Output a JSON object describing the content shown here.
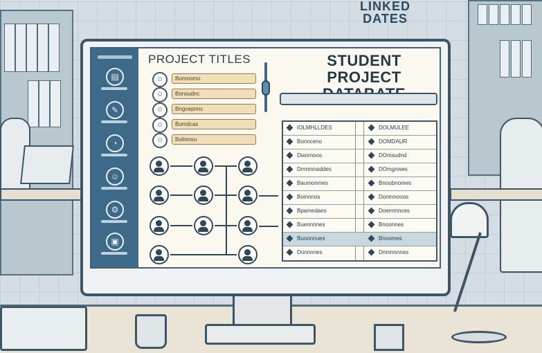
{
  "wall_sign": {
    "line1": "LINKED",
    "line2": "DATES"
  },
  "colors": {
    "sidebar": "#3d6a88",
    "accent_bar": "#f0dfb8",
    "ink": "#243f50"
  },
  "sidebar": {
    "items": [
      {
        "icon": "document-icon"
      },
      {
        "icon": "edit-icon"
      },
      {
        "icon": "chart-icon"
      },
      {
        "icon": "user-icon"
      },
      {
        "icon": "settings-icon"
      },
      {
        "icon": "archive-icon"
      }
    ]
  },
  "projects": {
    "title": "PROJECT TITLES",
    "rows": [
      {
        "label": "Bomnomo"
      },
      {
        "label": "Bonsudnc"
      },
      {
        "label": "Bngoepnnc"
      },
      {
        "label": "Bomdcas"
      },
      {
        "label": "Bolinnou"
      }
    ]
  },
  "database": {
    "title_line1": "STUDENT PROJECT",
    "title_line2": "DATABATE",
    "rows": [
      {
        "name": "IOLMHLLDES",
        "date": "DOLMULEE"
      },
      {
        "name": "Bonnceno",
        "date": "DOMDAUR"
      },
      {
        "name": "Dwornoos",
        "date": "DOmsudnd"
      },
      {
        "name": "Dmnmnaddes",
        "date": "DOmgnwes"
      },
      {
        "name": "Baumonmes",
        "date": "Bnoubnomes"
      },
      {
        "name": "Boinnnos",
        "date": "Donmnooos"
      },
      {
        "name": "Bpamedaes",
        "date": "Doemmnces"
      },
      {
        "name": "Buennnnes",
        "date": "Bnoonnes"
      },
      {
        "name": "Buoonnues",
        "date": "Bnoomes"
      },
      {
        "name": "Donnnnes",
        "date": "Dmnnnnnes"
      }
    ],
    "selected_row": 8
  }
}
